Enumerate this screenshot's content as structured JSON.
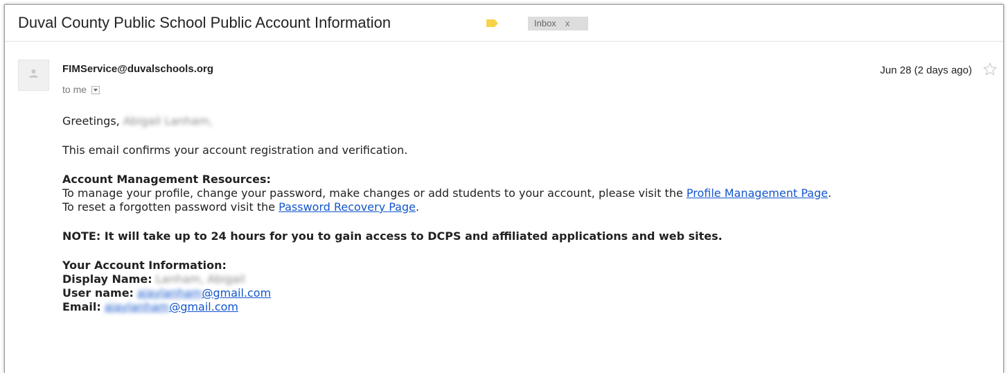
{
  "email": {
    "subject": "Duval County Public School Public Account Information",
    "inbox_label": "Inbox",
    "inbox_remove": "x",
    "sender": "FIMService@duvalschools.org",
    "recipient": "to me",
    "date": "Jun 28 (2 days ago)",
    "greeting": "Greetings,",
    "greeting_name": "Abigail Lanham,",
    "confirm_line": "This email confirms your account registration and verification.",
    "resources_heading": "Account Management Resources:",
    "manage_text": "To manage your profile, change your password, make changes or add students to your account, please visit the ",
    "profile_link": "Profile Management Page",
    "manage_end": ".",
    "reset_text": "To reset a forgotten password visit the ",
    "recovery_link": "Password Recovery Page",
    "reset_end": ".",
    "note": "NOTE: It will take up to 24 hours for you to gain access to DCPS and affiliated applications and web sites.",
    "account_heading": "Your Account Information:",
    "display_name_label": "Display Name:",
    "display_name_value": "Lanham, Abigail",
    "user_name_label": "User name:",
    "user_name_hidden": "ajaylanham",
    "user_name_domain": "@gmail.com",
    "email_label": "Email:",
    "email_hidden": "ajaylanham",
    "email_domain": "@gmail.com"
  },
  "colors": {
    "link": "#1155cc",
    "label_tag": "#f7d34a",
    "chip_bg": "#dddddd"
  },
  "icons": {
    "label_tag": "label-tag-icon",
    "avatar": "person-icon",
    "star": "star-outline-icon",
    "dropdown": "chevron-down-icon"
  }
}
